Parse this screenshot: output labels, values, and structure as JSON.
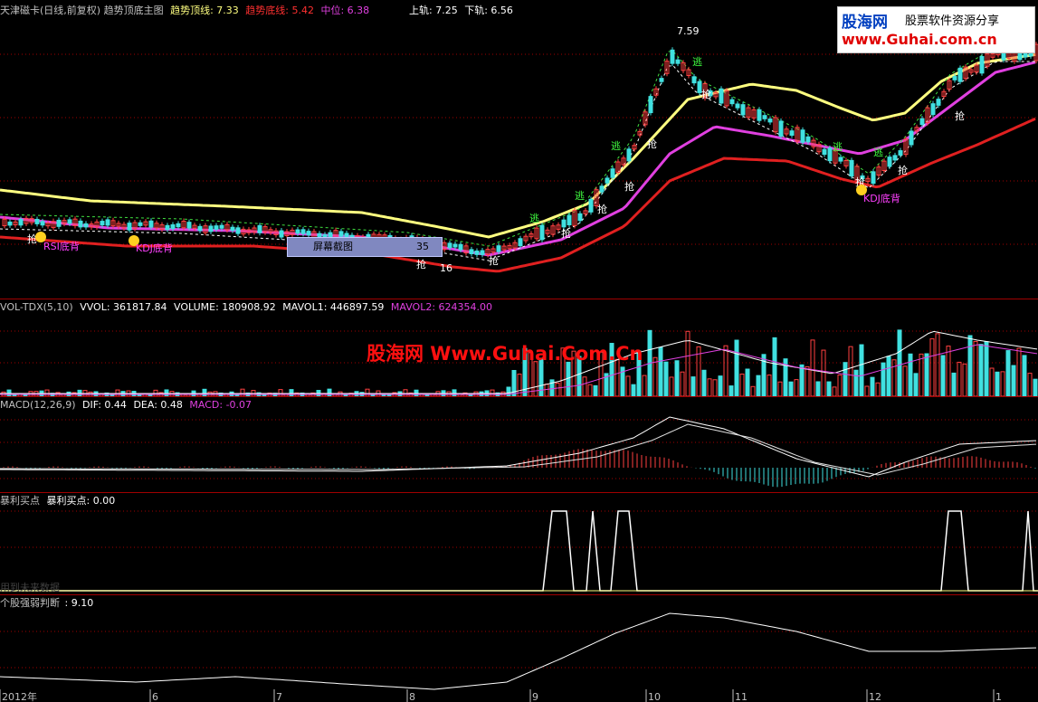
{
  "main_header": {
    "title": "天津磁卡(日线,前复权) 趋势顶底主图",
    "top_line": "趋势顶线: 7.33",
    "bottom_line": "趋势底线: 5.42",
    "mid_line": "中位: 6.38",
    "upper_band": "上轨: 7.25",
    "lower_band": "下轨: 6.56"
  },
  "main_annotations": {
    "peak_price": "7.59",
    "rsi_div": "RSI底背",
    "kdj_div_1": "KDJ底背",
    "kdj_div_2": "KDJ底背",
    "low_price": "16"
  },
  "tooltip": {
    "label": "屏幕截图",
    "value": "35"
  },
  "watermark_top": {
    "brand": "股海网",
    "slogan": "股票软件资源分享",
    "url": "www.Guhai.com.cn"
  },
  "watermark_mid": "股海网 Www.Guhai.Com.Cn",
  "vol_header": {
    "name": "VOL-TDX(5,10)",
    "vvol": "VVOL: 361817.84",
    "volume": "VOLUME: 180908.92",
    "mavol1": "MAVOL1: 446897.59",
    "mavol2": "MAVOL2: 624354.00"
  },
  "macd_header": {
    "name": "MACD(12,26,9)",
    "dif": "DIF: 0.44",
    "dea": "DEA: 0.48",
    "macd": "MACD: -0.07"
  },
  "profit_header": {
    "name": "暴利买点",
    "value": "暴利买点: 0.00",
    "note": "用到未来数据"
  },
  "strength_header": {
    "name": "个股强弱判断",
    "value": ": 9.10"
  },
  "x_axis": [
    "2012年",
    "6",
    "7",
    "8",
    "9",
    "10",
    "11",
    "12",
    "1"
  ],
  "colors": {
    "top_line": "#ffff80",
    "mid_line": "#e040e0",
    "bottom_line": "#e02020",
    "up_candle": "#ff4040",
    "down_candle": "#40e0e0",
    "grid": "#a00000"
  },
  "signal_glyphs": {
    "buy": "抢",
    "sell": "逃"
  }
}
